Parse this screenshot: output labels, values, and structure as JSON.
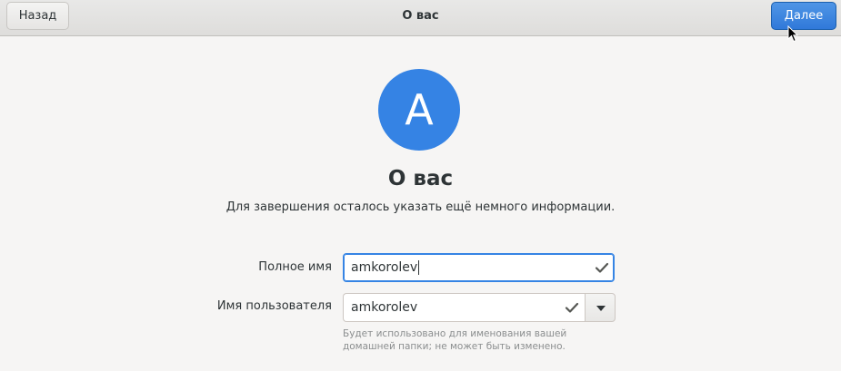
{
  "header": {
    "back_label": "Назад",
    "title": "О вас",
    "next_label": "Далее"
  },
  "avatar": {
    "letter": "A",
    "color": "#3583e4"
  },
  "page": {
    "title": "О вас",
    "subtitle": "Для завершения осталось указать ещё немного информации."
  },
  "form": {
    "fullname_label": "Полное имя",
    "fullname_value": "amkorolev",
    "username_label": "Имя пользователя",
    "username_value": "amkorolev",
    "username_hint": "Будет использовано для именования вашей домашней папки; не может быть изменено."
  },
  "colors": {
    "accent": "#3584e4",
    "check": "#555753"
  },
  "icons": {
    "check": "check-icon",
    "dropdown": "chevron-down-icon",
    "cursor": "mouse-pointer-icon"
  }
}
